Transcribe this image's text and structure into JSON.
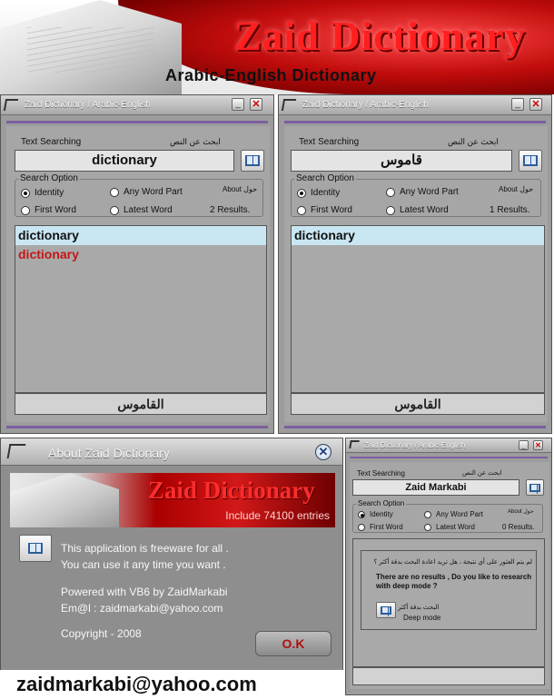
{
  "banner": {
    "title": "Zaid Dictionary",
    "subtitle": "Arabic-English Dictionary"
  },
  "window1": {
    "title": "Zaid Dictionary / Arabic-English",
    "text_searching": "Text Searching",
    "text_searching_ar": "ابحث عن النص",
    "search_value": "dictionary",
    "search_option": "Search Option",
    "about_ar": "About حول",
    "opt_identity": "Identity",
    "opt_any": "Any Word Part",
    "opt_first": "First Word",
    "opt_latest": "Latest Word",
    "result_count": "2 Results.",
    "results": [
      "dictionary",
      "dictionary"
    ],
    "bottom": "القاموس"
  },
  "window2": {
    "title": "Zaid Dictionary / Arabic-English",
    "text_searching": "Text Searching",
    "text_searching_ar": "ابحث عن النص",
    "search_value": "قاموس",
    "search_option": "Search Option",
    "about_ar": "About حول",
    "opt_identity": "Identity",
    "opt_any": "Any Word Part",
    "opt_first": "First Word",
    "opt_latest": "Latest Word",
    "result_count": "1 Results.",
    "results": [
      "dictionary"
    ],
    "bottom": "القاموس"
  },
  "about": {
    "title": "About Zaid Dictionary",
    "banner_title": "Zaid Dictionary",
    "banner_include": "Include 74100 entries",
    "line1": "This application is freeware for all .",
    "line2": "You can use it any time you want .",
    "line3": "Powered with VB6 by ZaidMarkabi",
    "line4": "Em@l : zaidmarkabi@yahoo.com",
    "copyright": "Copyright - 2008",
    "ok": "O.K"
  },
  "window3": {
    "title": "Zaid Dictionary / Arabic-English",
    "text_searching": "Text Searching",
    "text_searching_ar": "ابحث عن النص",
    "search_value": "Zaid Markabi",
    "search_option": "Search Option",
    "about_ar": "About حول",
    "opt_identity": "Identity",
    "opt_any": "Any Word Part",
    "opt_first": "First Word",
    "opt_latest": "Latest Word",
    "result_count": "0 Results.",
    "dialog_ar": "لم يتم العثور على أي نتيجة ، هل تريد اعادة البحث بدقة أكثر ؟",
    "dialog_en": "There are no results , Do you like to research with deep mode ?",
    "deep_ar": "البحث بدقة أكثر",
    "deep_en": "Deep mode"
  },
  "footer": {
    "email": "zaidmarkabi@yahoo.com"
  },
  "colors": {
    "accent_red": "#c31616",
    "selection": "#c9e6f3",
    "window_gray": "#a6a6a6",
    "divider_purple": "#7c5fa0"
  }
}
